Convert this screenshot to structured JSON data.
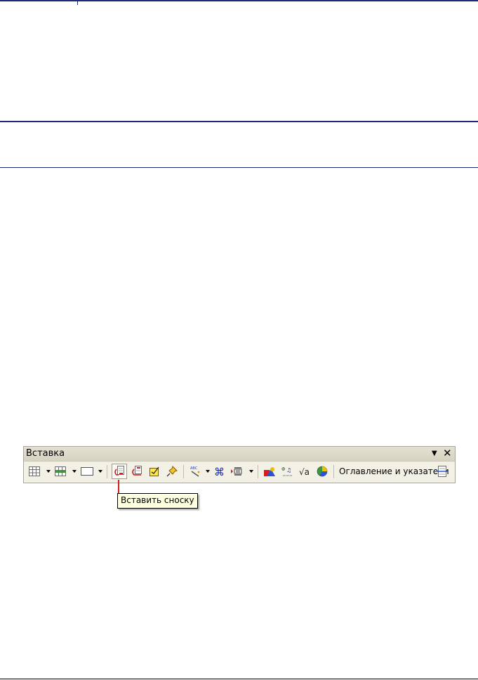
{
  "toolbar": {
    "title": "Вставка",
    "toc_label": "Оглавление и указатели"
  },
  "tooltip": {
    "text": "Вставить сноску"
  },
  "icons": {
    "table": "table-icon",
    "fields": "fields-icon",
    "frame": "frame-icon",
    "footnote": "footnote-icon",
    "endnote": "endnote-icon",
    "note": "note-icon",
    "bookmark": "bookmark-icon",
    "fontwork": "fontwork-icon",
    "special_char": "special-character-icon",
    "section": "section-icon",
    "image": "image-icon",
    "formula": "formula-icon",
    "math": "math-formula-icon",
    "chart": "chart-icon",
    "index_entry": "index-entry-icon"
  }
}
